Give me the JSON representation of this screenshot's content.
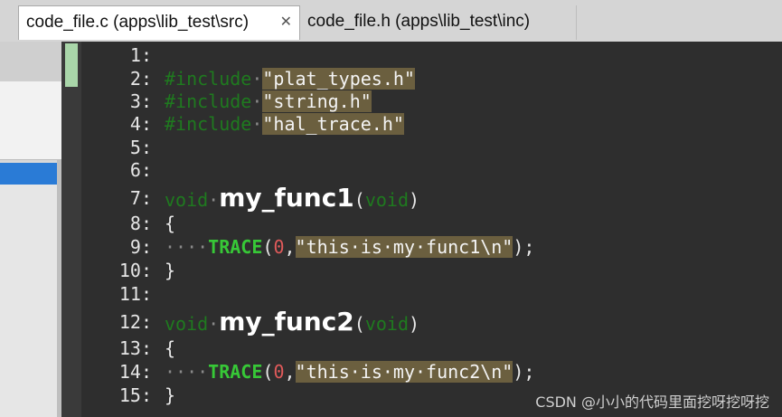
{
  "tabs": [
    {
      "label": "code_file.c (apps\\lib_test\\src)",
      "active": true,
      "close_glyph": "✕"
    },
    {
      "label": "code_file.h (apps\\lib_test\\inc)",
      "active": false
    }
  ],
  "editor": {
    "lines": [
      {
        "num": "1:",
        "tokens": []
      },
      {
        "num": "2:",
        "tokens": [
          {
            "t": "kw-inc",
            "v": "#include"
          },
          {
            "t": "dot",
            "v": "·"
          },
          {
            "t": "str",
            "v": "\"plat_types.h\""
          }
        ]
      },
      {
        "num": "3:",
        "tokens": [
          {
            "t": "kw-inc",
            "v": "#include"
          },
          {
            "t": "dot",
            "v": "·"
          },
          {
            "t": "str",
            "v": "\"string.h\""
          }
        ]
      },
      {
        "num": "4:",
        "tokens": [
          {
            "t": "kw-inc",
            "v": "#include"
          },
          {
            "t": "dot",
            "v": "·"
          },
          {
            "t": "str",
            "v": "\"hal_trace.h\""
          }
        ]
      },
      {
        "num": "5:",
        "tokens": []
      },
      {
        "num": "6:",
        "tokens": []
      },
      {
        "num": "7:",
        "tokens": [
          {
            "t": "kw-void",
            "v": "void"
          },
          {
            "t": "dot",
            "v": "·"
          },
          {
            "t": "fn",
            "v": "my_func1"
          },
          {
            "t": "punc",
            "v": "("
          },
          {
            "t": "kw-void",
            "v": "void"
          },
          {
            "t": "punc",
            "v": ")"
          }
        ]
      },
      {
        "num": "8:",
        "tokens": [
          {
            "t": "brace",
            "v": "{"
          }
        ]
      },
      {
        "num": "9:",
        "tokens": [
          {
            "t": "dot",
            "v": "····"
          },
          {
            "t": "mac",
            "v": "TRACE"
          },
          {
            "t": "punc",
            "v": "("
          },
          {
            "t": "num",
            "v": "0"
          },
          {
            "t": "punc",
            "v": ","
          },
          {
            "t": "str",
            "v": "\"this·is·my·func1\\n\""
          },
          {
            "t": "punc",
            "v": ");"
          }
        ]
      },
      {
        "num": "10:",
        "tokens": [
          {
            "t": "brace",
            "v": "}"
          }
        ]
      },
      {
        "num": "11:",
        "tokens": []
      },
      {
        "num": "12:",
        "tokens": [
          {
            "t": "kw-void",
            "v": "void"
          },
          {
            "t": "dot",
            "v": "·"
          },
          {
            "t": "fn",
            "v": "my_func2"
          },
          {
            "t": "punc",
            "v": "("
          },
          {
            "t": "kw-void",
            "v": "void"
          },
          {
            "t": "punc",
            "v": ")"
          }
        ]
      },
      {
        "num": "13:",
        "tokens": [
          {
            "t": "brace",
            "v": "{"
          }
        ]
      },
      {
        "num": "14:",
        "tokens": [
          {
            "t": "dot",
            "v": "····"
          },
          {
            "t": "mac",
            "v": "TRACE"
          },
          {
            "t": "punc",
            "v": "("
          },
          {
            "t": "num",
            "v": "0"
          },
          {
            "t": "punc",
            "v": ","
          },
          {
            "t": "str",
            "v": "\"this·is·my·func2\\n\""
          },
          {
            "t": "punc",
            "v": ");"
          }
        ]
      },
      {
        "num": "15:",
        "tokens": [
          {
            "t": "brace",
            "v": "}"
          }
        ]
      }
    ]
  },
  "watermark": "CSDN @小小的代码里面挖呀挖呀挖",
  "colors": {
    "string_bg": "#6b5f3f",
    "keyword": "#1f7a1f",
    "macro": "#37c837",
    "number": "#e05a5a",
    "selection": "#2a7bd6"
  }
}
